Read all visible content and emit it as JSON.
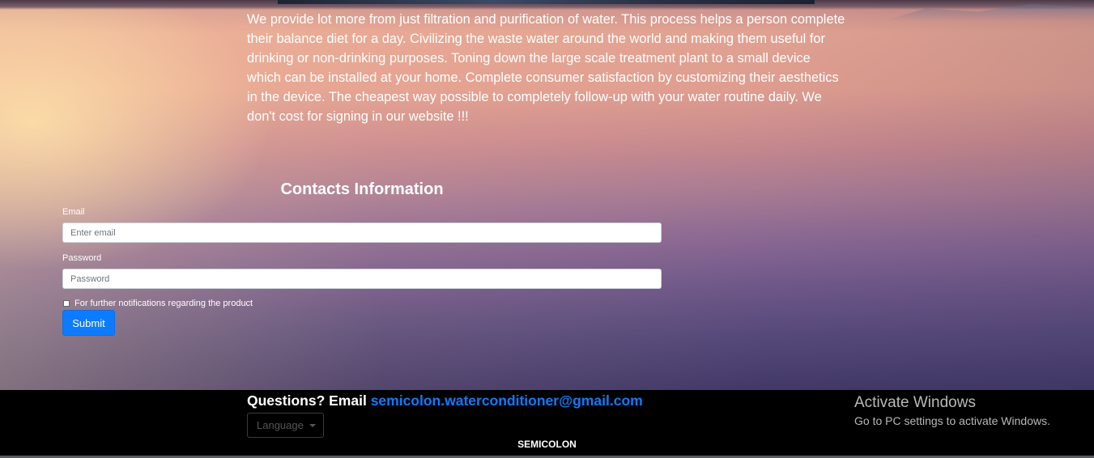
{
  "about": {
    "text": "We provide lot more from just filtration and purification of water. This process helps a person complete their balance diet for a day. Civilizing the waste water around the world and making them useful for drinking or non-drinking purposes. Toning down the large scale treatment plant to a small device which can be installed at your home. Complete consumer satisfaction by customizing their aesthetics in the device. The cheapest way possible to completely follow-up with your water routine daily. We don't cost for signing in our website !!!"
  },
  "contact": {
    "title": "Contacts Information",
    "email_label": "Email",
    "email_placeholder": "Enter email",
    "password_label": "Password",
    "password_placeholder": "Password",
    "checkbox_label": "For further notifications regarding the product",
    "submit_label": "Submit"
  },
  "footer": {
    "questions_prefix": "Questions? Email",
    "email_link": "semicolon.waterconditioner@gmail.com",
    "language_label": "Language",
    "brand": "SEMICOLON"
  },
  "activation_notice": {
    "title": "Activate Windows",
    "subtitle": "Go to PC settings to activate Windows."
  }
}
